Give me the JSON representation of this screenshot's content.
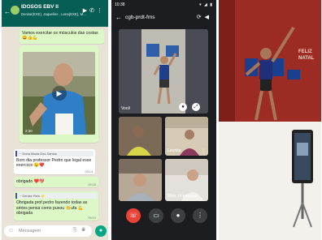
{
  "chat": {
    "group_name": "IDOSOS EBV II",
    "members": "Denise(EXE), Jaqueline , Lena(EXE), M...",
    "header_icons": [
      "video-icon",
      "phone-icon",
      "menu-icon"
    ],
    "messages": [
      {
        "text": "Vamos exercitar os músculos das costas😀👍💪",
        "time": ""
      },
      {
        "text": "",
        "time": "2:30"
      },
      {
        "quote": "~ Dona Maria Dos Santos",
        "text": "Bom dia professor Pedro que legal esse exercicio 😉❤️",
        "time": "09:14"
      },
      {
        "text": "obrigado ❤️💖",
        "time": "09:18"
      },
      {
        "quote": "~ Denise Reis 🌟",
        "text": "Obrigada prof.pedro fazendo todas as séries pensa como puxou 👏ufa 💪 obrigada",
        "time": "09:19"
      }
    ],
    "input_placeholder": "Mensagem"
  },
  "meeting": {
    "time": "10:38",
    "status_right": "▾ ◢ ▮",
    "room_title": "cgb-prdt-fms",
    "self_label": "Você",
    "participants": [
      "",
      "Leonita",
      "",
      "Mais 14 pessoas"
    ],
    "colors": {
      "end_call": "#ea4335",
      "background": "#1c1d20"
    }
  },
  "studio": {
    "wall_text": "FELIZ\nNATAL"
  }
}
